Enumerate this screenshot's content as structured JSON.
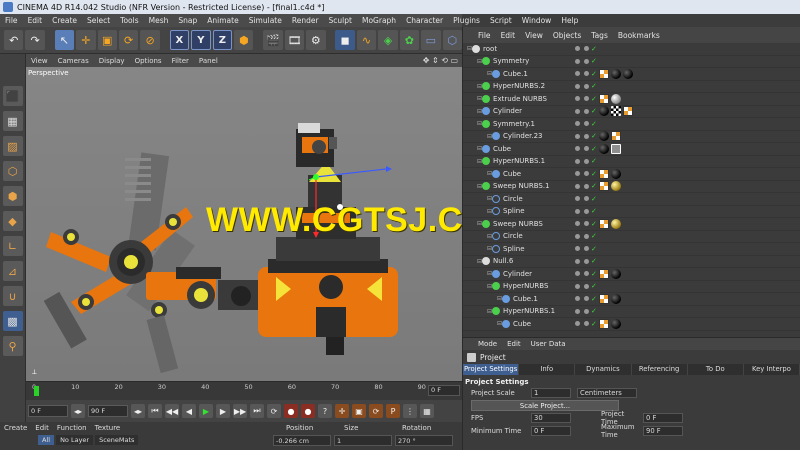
{
  "window": {
    "title": "CINEMA 4D R14.042 Studio (NFR Version - Restricted License) - [final1.c4d *]"
  },
  "menu": [
    "File",
    "Edit",
    "Create",
    "Select",
    "Tools",
    "Mesh",
    "Snap",
    "Animate",
    "Simulate",
    "Render",
    "Sculpt",
    "MoGraph",
    "Character",
    "Plugins",
    "Script",
    "Window",
    "Help"
  ],
  "viewport": {
    "menu": [
      "View",
      "Cameras",
      "Display",
      "Options",
      "Filter",
      "Panel"
    ],
    "label": "Perspective",
    "watermark": "WWW.CGTSJ.COM"
  },
  "timeline": {
    "ticks": [
      "0",
      "10",
      "20",
      "30",
      "40",
      "50",
      "60",
      "70",
      "80",
      "90"
    ],
    "current_frame": "0 F"
  },
  "transport": {
    "start": "0 F",
    "end": "90 F"
  },
  "materials": {
    "menu": [
      "Create",
      "Edit",
      "Function",
      "Texture"
    ],
    "tabs": [
      "All",
      "No Layer",
      "SceneMats"
    ]
  },
  "coordinates": {
    "headers": [
      "Position",
      "Size",
      "Rotation"
    ],
    "x_position": "-0.266 cm",
    "x_size": "1",
    "x_rotation": "270 °"
  },
  "object_manager": {
    "menu": [
      "File",
      "Edit",
      "View",
      "Objects",
      "Tags",
      "Bookmarks"
    ],
    "objects": [
      {
        "name": "root",
        "indent": 0,
        "icon": "null",
        "tags": []
      },
      {
        "name": "Symmetry",
        "indent": 1,
        "icon": "symmetry",
        "tags": []
      },
      {
        "name": "Cube.1",
        "indent": 2,
        "icon": "primitive",
        "tags": [
          "phong",
          "mat",
          "mat"
        ]
      },
      {
        "name": "HyperNURBS.2",
        "indent": 1,
        "icon": "nurbs",
        "tags": []
      },
      {
        "name": "Extrude NURBS",
        "indent": 1,
        "icon": "nurbs",
        "tags": [
          "phong",
          "matw"
        ]
      },
      {
        "name": "Cylinder",
        "indent": 1,
        "icon": "primitive",
        "tags": [
          "mat",
          "chkr",
          "phong"
        ]
      },
      {
        "name": "Symmetry.1",
        "indent": 1,
        "icon": "symmetry",
        "tags": []
      },
      {
        "name": "Cylinder.23",
        "indent": 2,
        "icon": "primitive",
        "tags": [
          "mat",
          "phong"
        ]
      },
      {
        "name": "Cube",
        "indent": 1,
        "icon": "primitive",
        "tags": [
          "mat",
          "sel"
        ]
      },
      {
        "name": "HyperNURBS.1",
        "indent": 1,
        "icon": "nurbs",
        "tags": []
      },
      {
        "name": "Cube",
        "indent": 2,
        "icon": "primitive",
        "tags": [
          "phong",
          "mat"
        ]
      },
      {
        "name": "Sweep NURBS.1",
        "indent": 1,
        "icon": "nurbs",
        "tags": [
          "phong",
          "matg"
        ]
      },
      {
        "name": "Circle",
        "indent": 2,
        "icon": "spline",
        "tags": []
      },
      {
        "name": "Spline",
        "indent": 2,
        "icon": "spline",
        "tags": []
      },
      {
        "name": "Sweep NURBS",
        "indent": 1,
        "icon": "nurbs",
        "tags": [
          "phong",
          "matg"
        ]
      },
      {
        "name": "Circle",
        "indent": 2,
        "icon": "spline",
        "tags": []
      },
      {
        "name": "Spline",
        "indent": 2,
        "icon": "spline",
        "tags": []
      },
      {
        "name": "Null.6",
        "indent": 1,
        "icon": "null",
        "tags": []
      },
      {
        "name": "Cylinder",
        "indent": 2,
        "icon": "primitive",
        "tags": [
          "phong",
          "mat"
        ]
      },
      {
        "name": "HyperNURBS",
        "indent": 2,
        "icon": "nurbs",
        "tags": []
      },
      {
        "name": "Cube.1",
        "indent": 3,
        "icon": "primitive",
        "tags": [
          "phong",
          "mat"
        ]
      },
      {
        "name": "HyperNURBS.1",
        "indent": 2,
        "icon": "nurbs",
        "tags": []
      },
      {
        "name": "Cube",
        "indent": 3,
        "icon": "primitive",
        "tags": [
          "phong",
          "mat"
        ]
      }
    ]
  },
  "attribute_manager": {
    "menu": [
      "Mode",
      "Edit",
      "User Data"
    ],
    "title": "Project",
    "tabs": [
      "Project Settings",
      "Info",
      "Dynamics",
      "Referencing",
      "To Do",
      "Key Interpo"
    ],
    "section": "Project Settings",
    "project_scale_label": "Project Scale",
    "project_scale_value": "1",
    "project_scale_unit": "Centimeters",
    "scale_button": "Scale Project...",
    "fps_label": "FPS",
    "fps_value": "30",
    "project_time_label": "Project Time",
    "project_time_value": "0 F",
    "min_time_label": "Minimum Time",
    "min_time_value": "0 F",
    "max_time_label": "Maximum Time",
    "max_time_value": "90 F"
  },
  "colors": {
    "accent": "#3f5f90",
    "watermark": "#ffea00",
    "check": "#3cd23c",
    "robot_orange": "#f07a10"
  }
}
